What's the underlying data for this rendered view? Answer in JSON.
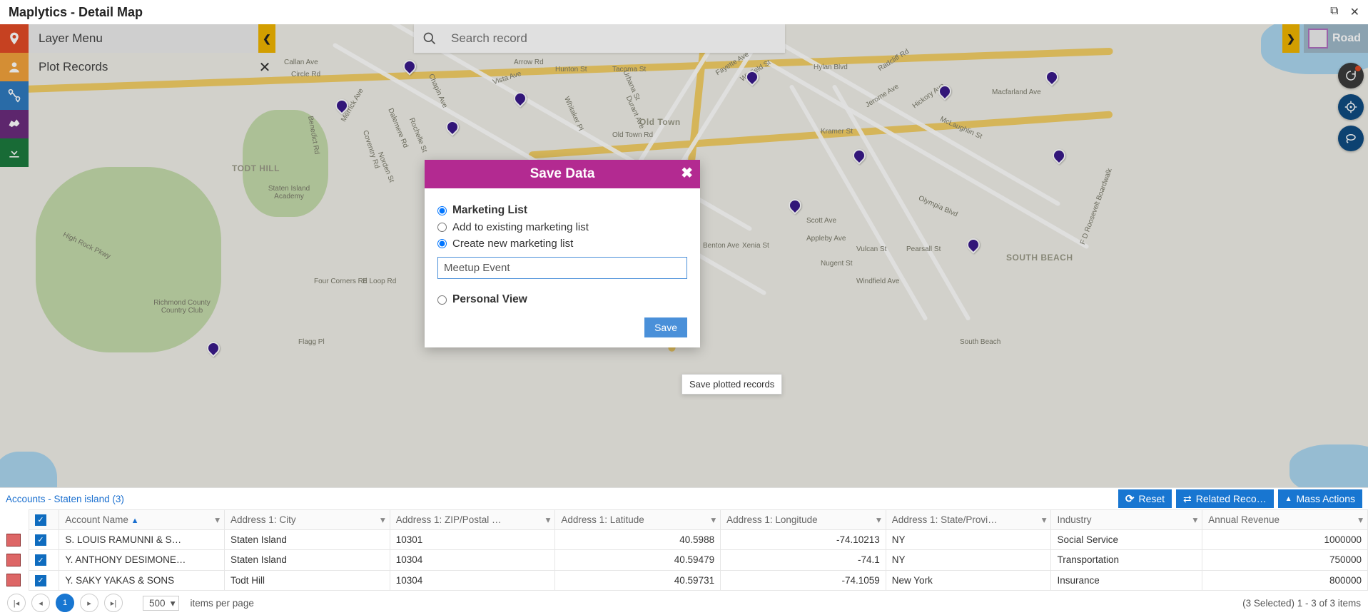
{
  "title": "Maplytics - Detail Map",
  "layer_menu": "Layer Menu",
  "plot_records": "Plot Records",
  "search_placeholder": "Search record",
  "map_type": "Road",
  "map_labels": {
    "todt_hill": "TODT HILL",
    "old_town": "Old Town",
    "south_beach": "SOUTH BEACH",
    "sb2": "South Beach",
    "staten_island_academy": "Staten Island Academy",
    "richmond_cc": "Richmond County Country Club",
    "hylan": "Hylan Blvd",
    "old_town_rd": "Old Town Rd",
    "high_rock": "High Rock Pkwy",
    "dalemere": "Dalemere Rd",
    "rochelle": "Rochelle St",
    "norden": "Norden St",
    "e_loop": "E Loop Rd",
    "flagg": "Flagg Pl",
    "benedict": "Benedict Rd",
    "circle": "Circle Rd",
    "merrick": "Merrick Ave",
    "coventry": "Coventry Rd",
    "four_corners": "Four Corners Rd",
    "callan": "Callan Ave",
    "arrow": "Arrow Rd",
    "chapin": "Chapin Ave",
    "hunton": "Hunton St",
    "tacoma": "Tacoma St",
    "urbana": "Urbana St",
    "durant": "Durant Ave",
    "fayette": "Fayette Ave",
    "winfield": "Winfield St",
    "whitaker": "Whitaker Pl",
    "benton": "Benton Ave",
    "xenia": "Xenia St",
    "scott": "Scott Ave",
    "appleby": "Appleby Ave",
    "kramer": "Kramer St",
    "jerome": "Jerome Ave",
    "nugent": "Nugent St",
    "hickory": "Hickory Ave",
    "radcliff": "Radcliff Rd",
    "vista": "Vista Ave",
    "olympia": "Olympia Blvd",
    "vulcan": "Vulcan St",
    "pearsall": "Pearsall St",
    "windfield": "Windfield Ave",
    "mclaughlin": "McLaughlin St",
    "macfarland": "Macfarland Ave",
    "boulevard": "F D Roosevelt Boardwalk"
  },
  "modal": {
    "title": "Save Data",
    "opt_marketing": "Marketing List",
    "opt_add_existing": "Add to existing marketing list",
    "opt_create_new": "Create new marketing list",
    "input_value": "Meetup Event",
    "opt_personal_view": "Personal View",
    "save_btn": "Save",
    "tooltip": "Save plotted records"
  },
  "grid": {
    "title": "Accounts - Staten island (3)",
    "reset": "Reset",
    "related": "Related Reco…",
    "mass": "Mass Actions",
    "cols": {
      "name": "Account Name",
      "city": "Address 1: City",
      "zip": "Address 1: ZIP/Postal …",
      "lat": "Address 1: Latitude",
      "lon": "Address 1: Longitude",
      "state": "Address 1: State/Provi…",
      "ind": "Industry",
      "rev": "Annual Revenue"
    },
    "rows": [
      {
        "name": "S. LOUIS RAMUNNI & S…",
        "city": "Staten Island",
        "zip": "10301",
        "lat": "40.5988",
        "lon": "-74.10213",
        "state": "NY",
        "ind": "Social Service",
        "rev": "1000000"
      },
      {
        "name": "Y. ANTHONY DESIMONE…",
        "city": "Staten Island",
        "zip": "10304",
        "lat": "40.59479",
        "lon": "-74.1",
        "state": "NY",
        "ind": "Transportation",
        "rev": "750000"
      },
      {
        "name": "Y. SAKY YAKAS & SONS",
        "city": "Todt Hill",
        "zip": "10304",
        "lat": "40.59731",
        "lon": "-74.1059",
        "state": "New York",
        "ind": "Insurance",
        "rev": "800000"
      }
    ],
    "pager": {
      "page": "1",
      "size": "500",
      "per_page": "items per page",
      "summary": "(3 Selected) 1 - 3 of 3 items"
    }
  }
}
